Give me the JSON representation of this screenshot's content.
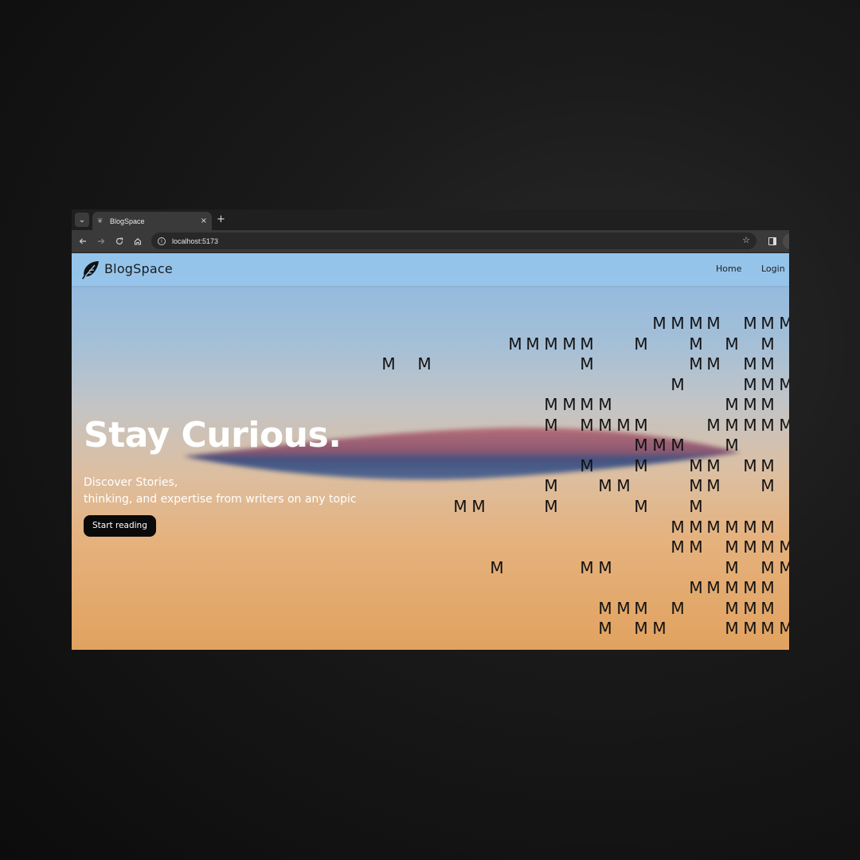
{
  "browser": {
    "tab_title": "BlogSpace",
    "tab_close_glyph": "×",
    "new_tab_glyph": "+",
    "tab_menu_glyph": "⌄",
    "url": "localhost:5173",
    "icons": [
      "tab-search-icon",
      "favicon-icon",
      "close-icon",
      "plus-icon",
      "back-icon",
      "forward-icon",
      "reload-icon",
      "home-icon",
      "info-icon",
      "star-icon",
      "side-panel-icon"
    ]
  },
  "site": {
    "brand": "BlogSpace",
    "nav": {
      "home": "Home",
      "login": "Login"
    },
    "hero": {
      "title": "Stay Curious.",
      "subtitle_line1": "Discover Stories,",
      "subtitle_line2": "thinking, and expertise from writers on any topic",
      "cta": "Start reading"
    },
    "decoration_glyph": "M",
    "colors": {
      "sky_top": "#8db8e2",
      "sky_bottom": "#e1a25f",
      "nav_bg": "#96c4ec",
      "cta_bg": "#0a0a0a"
    }
  }
}
